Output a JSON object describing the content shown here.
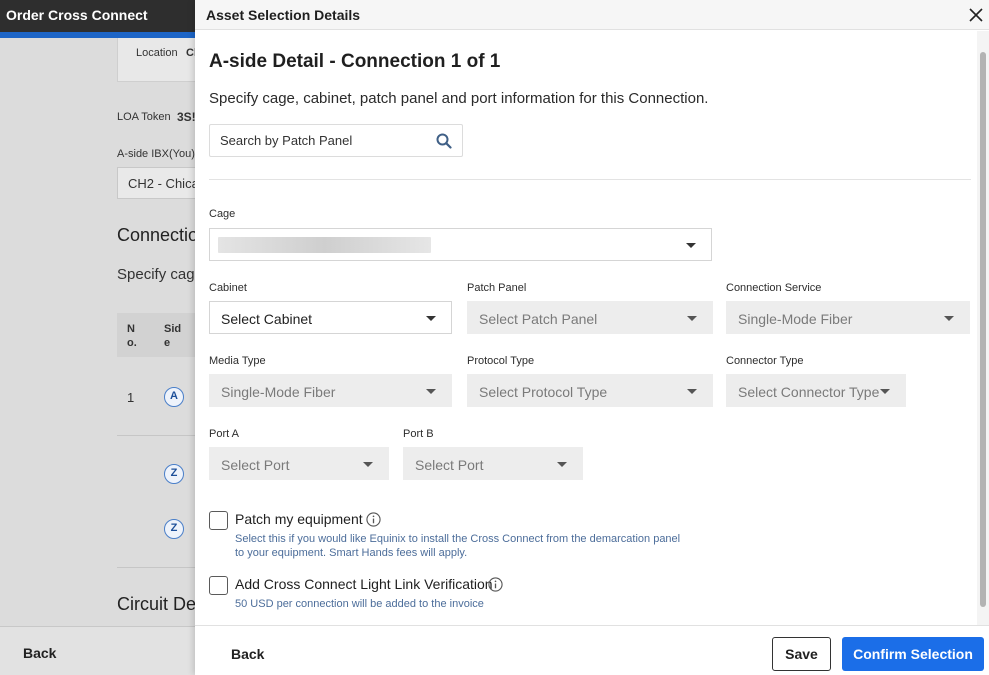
{
  "background": {
    "title": "Order Cross Connect",
    "location_label": "Location",
    "location_value": "Cl",
    "loa_label": "LOA Token",
    "loa_value": "3S!",
    "aside_label": "A-side IBX(You)",
    "aside_value": "CH2 - Chica",
    "connections_heading": "Connectio",
    "connections_sub": "Specify cag",
    "table_col_no": "N\no.",
    "table_col_side": "Sid\ne",
    "row_number": "1",
    "side_a": "A",
    "side_z": "Z",
    "circuit_heading": "Circuit De",
    "back_label": "Back"
  },
  "drawer": {
    "title": "Asset Selection Details",
    "heading": "A-side Detail - Connection 1 of 1",
    "description": "Specify cage, cabinet, patch panel and port information for this Connection.",
    "search_placeholder": "Search by Patch Panel",
    "fields": {
      "cage": {
        "label": "Cage",
        "value": ""
      },
      "cabinet": {
        "label": "Cabinet",
        "value": "Select Cabinet"
      },
      "patch_panel": {
        "label": "Patch Panel",
        "value": "Select Patch Panel"
      },
      "connection_service": {
        "label": "Connection Service",
        "value": "Single-Mode Fiber"
      },
      "media_type": {
        "label": "Media Type",
        "value": "Single-Mode Fiber"
      },
      "protocol_type": {
        "label": "Protocol Type",
        "value": "Select Protocol Type"
      },
      "connector_type": {
        "label": "Connector Type",
        "value": "Select Connector Type"
      },
      "port_a": {
        "label": "Port A",
        "value": "Select Port"
      },
      "port_b": {
        "label": "Port B",
        "value": "Select Port"
      }
    },
    "patch_equipment": {
      "label": "Patch my equipment",
      "help_line1": "Select this if you would like Equinix to install the Cross Connect from the demarcation panel",
      "help_line2": "to your equipment. Smart Hands fees will apply."
    },
    "light_link": {
      "label": "Add Cross Connect Light Link Verification",
      "help": "50 USD per connection will be added to the invoice"
    },
    "footer": {
      "back_label": "Back",
      "save_label": "Save",
      "confirm_label": "Confirm Selection"
    }
  }
}
